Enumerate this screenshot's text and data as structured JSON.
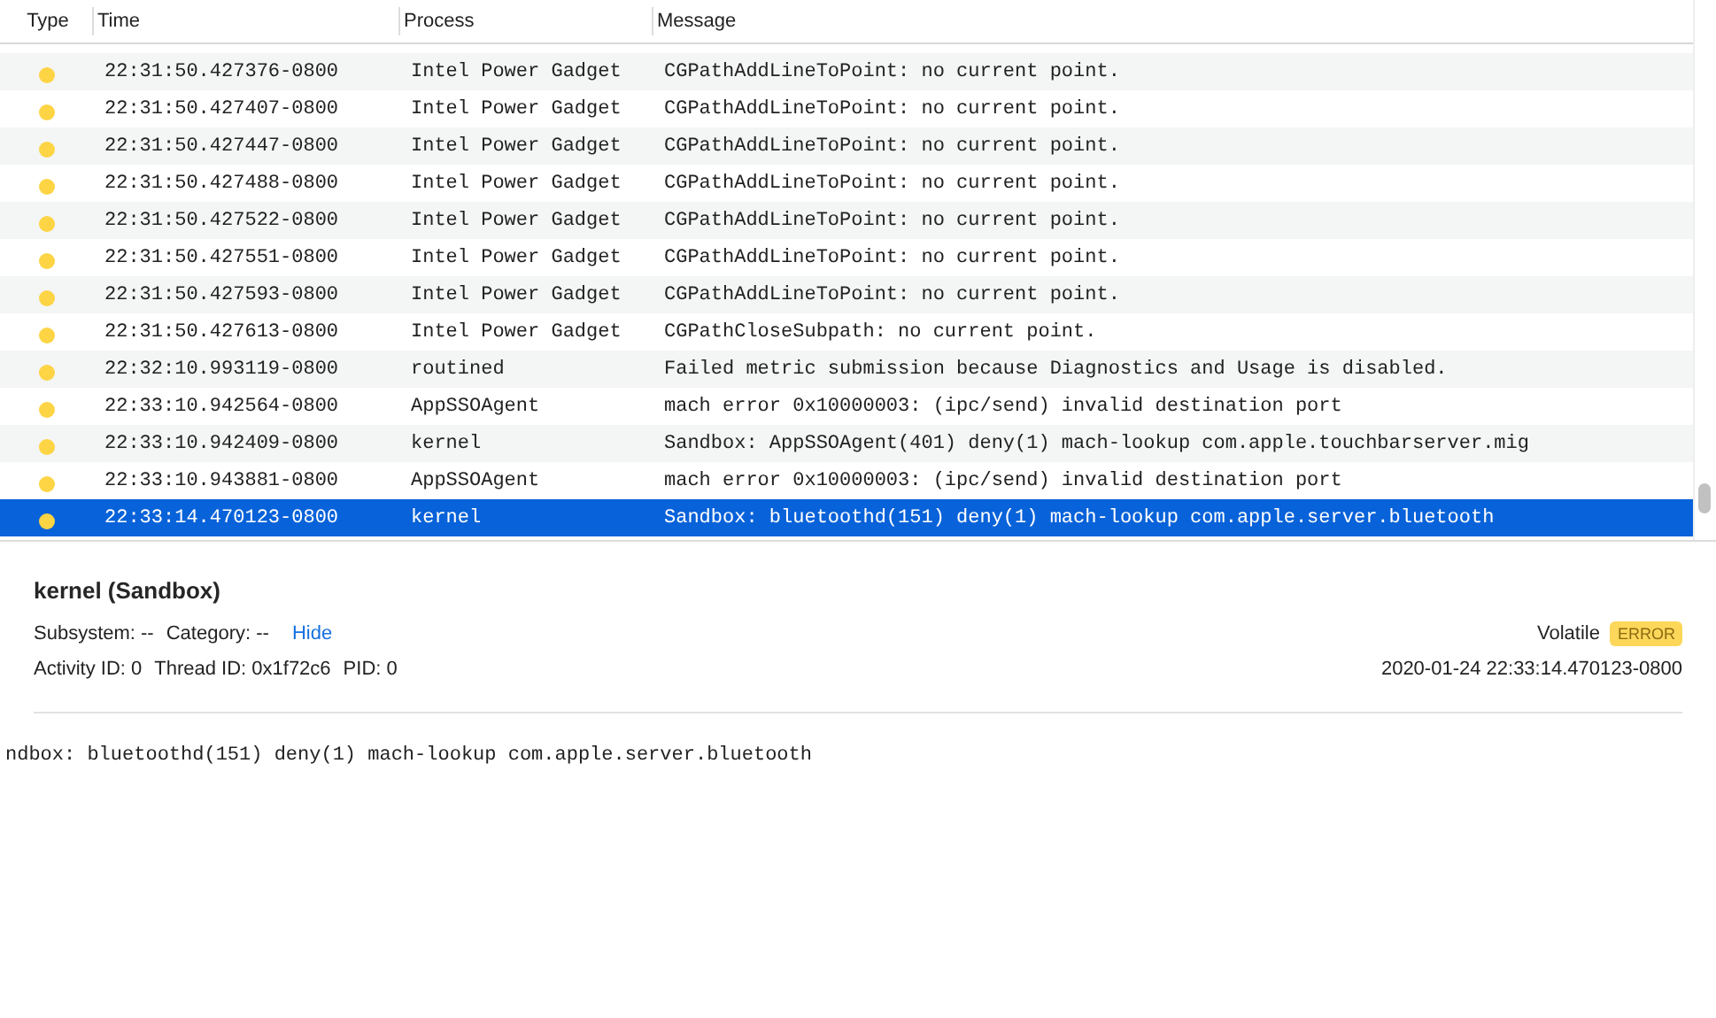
{
  "table": {
    "columns": [
      "Type",
      "Time",
      "Process",
      "Message"
    ],
    "rows": [
      {
        "time": "22:31:50.427376-0800",
        "process": "Intel Power Gadget",
        "message": "CGPathAddLineToPoint: no current point.",
        "selected": false
      },
      {
        "time": "22:31:50.427407-0800",
        "process": "Intel Power Gadget",
        "message": "CGPathAddLineToPoint: no current point.",
        "selected": false
      },
      {
        "time": "22:31:50.427447-0800",
        "process": "Intel Power Gadget",
        "message": "CGPathAddLineToPoint: no current point.",
        "selected": false
      },
      {
        "time": "22:31:50.427488-0800",
        "process": "Intel Power Gadget",
        "message": "CGPathAddLineToPoint: no current point.",
        "selected": false
      },
      {
        "time": "22:31:50.427522-0800",
        "process": "Intel Power Gadget",
        "message": "CGPathAddLineToPoint: no current point.",
        "selected": false
      },
      {
        "time": "22:31:50.427551-0800",
        "process": "Intel Power Gadget",
        "message": "CGPathAddLineToPoint: no current point.",
        "selected": false
      },
      {
        "time": "22:31:50.427593-0800",
        "process": "Intel Power Gadget",
        "message": "CGPathAddLineToPoint: no current point.",
        "selected": false
      },
      {
        "time": "22:31:50.427613-0800",
        "process": "Intel Power Gadget",
        "message": "CGPathCloseSubpath: no current point.",
        "selected": false
      },
      {
        "time": "22:32:10.993119-0800",
        "process": "routined",
        "message": "Failed metric submission because Diagnostics and Usage is disabled.",
        "selected": false
      },
      {
        "time": "22:33:10.942564-0800",
        "process": "AppSSOAgent",
        "message": "mach error 0x10000003: (ipc/send) invalid destination port",
        "selected": false
      },
      {
        "time": "22:33:10.942409-0800",
        "process": "kernel",
        "message": "Sandbox: AppSSOAgent(401) deny(1) mach-lookup com.apple.touchbarserver.mig",
        "selected": false
      },
      {
        "time": "22:33:10.943881-0800",
        "process": "AppSSOAgent",
        "message": "mach error 0x10000003: (ipc/send) invalid destination port",
        "selected": false
      },
      {
        "time": "22:33:14.470123-0800",
        "process": "kernel",
        "message": "Sandbox: bluetoothd(151) deny(1) mach-lookup com.apple.server.bluetooth",
        "selected": true
      }
    ]
  },
  "detail": {
    "title": "kernel (Sandbox)",
    "subsystem": "Subsystem: --",
    "category": "Category: --",
    "hide_link": "Hide",
    "volatile": "Volatile",
    "badge": "ERROR",
    "activity_id": "Activity ID: 0",
    "thread_id": "Thread ID: 0x1f72c6",
    "pid": "PID: 0",
    "timestamp": "2020-01-24 22:33:14.470123-0800",
    "message": "ndbox: bluetoothd(151) deny(1) mach-lookup com.apple.server.bluetooth"
  }
}
